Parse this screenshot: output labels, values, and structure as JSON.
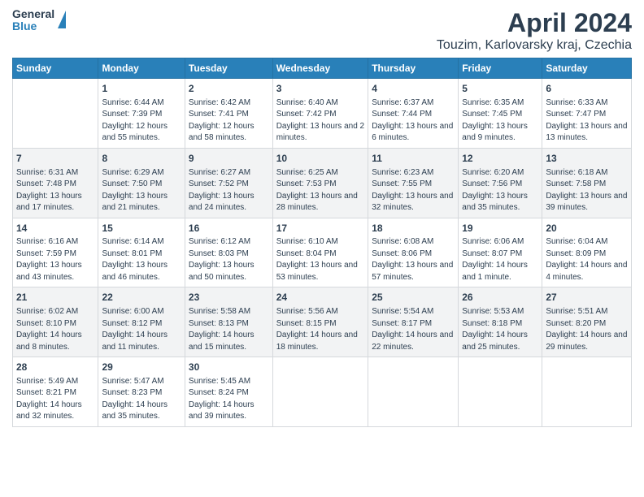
{
  "header": {
    "logo_general": "General",
    "logo_blue": "Blue",
    "title": "April 2024",
    "subtitle": "Touzim, Karlovarsky kraj, Czechia"
  },
  "days_of_week": [
    "Sunday",
    "Monday",
    "Tuesday",
    "Wednesday",
    "Thursday",
    "Friday",
    "Saturday"
  ],
  "weeks": [
    [
      {
        "day": "",
        "empty": true
      },
      {
        "day": "1",
        "sunrise": "Sunrise: 6:44 AM",
        "sunset": "Sunset: 7:39 PM",
        "daylight": "Daylight: 12 hours and 55 minutes."
      },
      {
        "day": "2",
        "sunrise": "Sunrise: 6:42 AM",
        "sunset": "Sunset: 7:41 PM",
        "daylight": "Daylight: 12 hours and 58 minutes."
      },
      {
        "day": "3",
        "sunrise": "Sunrise: 6:40 AM",
        "sunset": "Sunset: 7:42 PM",
        "daylight": "Daylight: 13 hours and 2 minutes."
      },
      {
        "day": "4",
        "sunrise": "Sunrise: 6:37 AM",
        "sunset": "Sunset: 7:44 PM",
        "daylight": "Daylight: 13 hours and 6 minutes."
      },
      {
        "day": "5",
        "sunrise": "Sunrise: 6:35 AM",
        "sunset": "Sunset: 7:45 PM",
        "daylight": "Daylight: 13 hours and 9 minutes."
      },
      {
        "day": "6",
        "sunrise": "Sunrise: 6:33 AM",
        "sunset": "Sunset: 7:47 PM",
        "daylight": "Daylight: 13 hours and 13 minutes."
      }
    ],
    [
      {
        "day": "7",
        "sunrise": "Sunrise: 6:31 AM",
        "sunset": "Sunset: 7:48 PM",
        "daylight": "Daylight: 13 hours and 17 minutes."
      },
      {
        "day": "8",
        "sunrise": "Sunrise: 6:29 AM",
        "sunset": "Sunset: 7:50 PM",
        "daylight": "Daylight: 13 hours and 21 minutes."
      },
      {
        "day": "9",
        "sunrise": "Sunrise: 6:27 AM",
        "sunset": "Sunset: 7:52 PM",
        "daylight": "Daylight: 13 hours and 24 minutes."
      },
      {
        "day": "10",
        "sunrise": "Sunrise: 6:25 AM",
        "sunset": "Sunset: 7:53 PM",
        "daylight": "Daylight: 13 hours and 28 minutes."
      },
      {
        "day": "11",
        "sunrise": "Sunrise: 6:23 AM",
        "sunset": "Sunset: 7:55 PM",
        "daylight": "Daylight: 13 hours and 32 minutes."
      },
      {
        "day": "12",
        "sunrise": "Sunrise: 6:20 AM",
        "sunset": "Sunset: 7:56 PM",
        "daylight": "Daylight: 13 hours and 35 minutes."
      },
      {
        "day": "13",
        "sunrise": "Sunrise: 6:18 AM",
        "sunset": "Sunset: 7:58 PM",
        "daylight": "Daylight: 13 hours and 39 minutes."
      }
    ],
    [
      {
        "day": "14",
        "sunrise": "Sunrise: 6:16 AM",
        "sunset": "Sunset: 7:59 PM",
        "daylight": "Daylight: 13 hours and 43 minutes."
      },
      {
        "day": "15",
        "sunrise": "Sunrise: 6:14 AM",
        "sunset": "Sunset: 8:01 PM",
        "daylight": "Daylight: 13 hours and 46 minutes."
      },
      {
        "day": "16",
        "sunrise": "Sunrise: 6:12 AM",
        "sunset": "Sunset: 8:03 PM",
        "daylight": "Daylight: 13 hours and 50 minutes."
      },
      {
        "day": "17",
        "sunrise": "Sunrise: 6:10 AM",
        "sunset": "Sunset: 8:04 PM",
        "daylight": "Daylight: 13 hours and 53 minutes."
      },
      {
        "day": "18",
        "sunrise": "Sunrise: 6:08 AM",
        "sunset": "Sunset: 8:06 PM",
        "daylight": "Daylight: 13 hours and 57 minutes."
      },
      {
        "day": "19",
        "sunrise": "Sunrise: 6:06 AM",
        "sunset": "Sunset: 8:07 PM",
        "daylight": "Daylight: 14 hours and 1 minute."
      },
      {
        "day": "20",
        "sunrise": "Sunrise: 6:04 AM",
        "sunset": "Sunset: 8:09 PM",
        "daylight": "Daylight: 14 hours and 4 minutes."
      }
    ],
    [
      {
        "day": "21",
        "sunrise": "Sunrise: 6:02 AM",
        "sunset": "Sunset: 8:10 PM",
        "daylight": "Daylight: 14 hours and 8 minutes."
      },
      {
        "day": "22",
        "sunrise": "Sunrise: 6:00 AM",
        "sunset": "Sunset: 8:12 PM",
        "daylight": "Daylight: 14 hours and 11 minutes."
      },
      {
        "day": "23",
        "sunrise": "Sunrise: 5:58 AM",
        "sunset": "Sunset: 8:13 PM",
        "daylight": "Daylight: 14 hours and 15 minutes."
      },
      {
        "day": "24",
        "sunrise": "Sunrise: 5:56 AM",
        "sunset": "Sunset: 8:15 PM",
        "daylight": "Daylight: 14 hours and 18 minutes."
      },
      {
        "day": "25",
        "sunrise": "Sunrise: 5:54 AM",
        "sunset": "Sunset: 8:17 PM",
        "daylight": "Daylight: 14 hours and 22 minutes."
      },
      {
        "day": "26",
        "sunrise": "Sunrise: 5:53 AM",
        "sunset": "Sunset: 8:18 PM",
        "daylight": "Daylight: 14 hours and 25 minutes."
      },
      {
        "day": "27",
        "sunrise": "Sunrise: 5:51 AM",
        "sunset": "Sunset: 8:20 PM",
        "daylight": "Daylight: 14 hours and 29 minutes."
      }
    ],
    [
      {
        "day": "28",
        "sunrise": "Sunrise: 5:49 AM",
        "sunset": "Sunset: 8:21 PM",
        "daylight": "Daylight: 14 hours and 32 minutes."
      },
      {
        "day": "29",
        "sunrise": "Sunrise: 5:47 AM",
        "sunset": "Sunset: 8:23 PM",
        "daylight": "Daylight: 14 hours and 35 minutes."
      },
      {
        "day": "30",
        "sunrise": "Sunrise: 5:45 AM",
        "sunset": "Sunset: 8:24 PM",
        "daylight": "Daylight: 14 hours and 39 minutes."
      },
      {
        "day": "",
        "empty": true
      },
      {
        "day": "",
        "empty": true
      },
      {
        "day": "",
        "empty": true
      },
      {
        "day": "",
        "empty": true
      }
    ]
  ]
}
